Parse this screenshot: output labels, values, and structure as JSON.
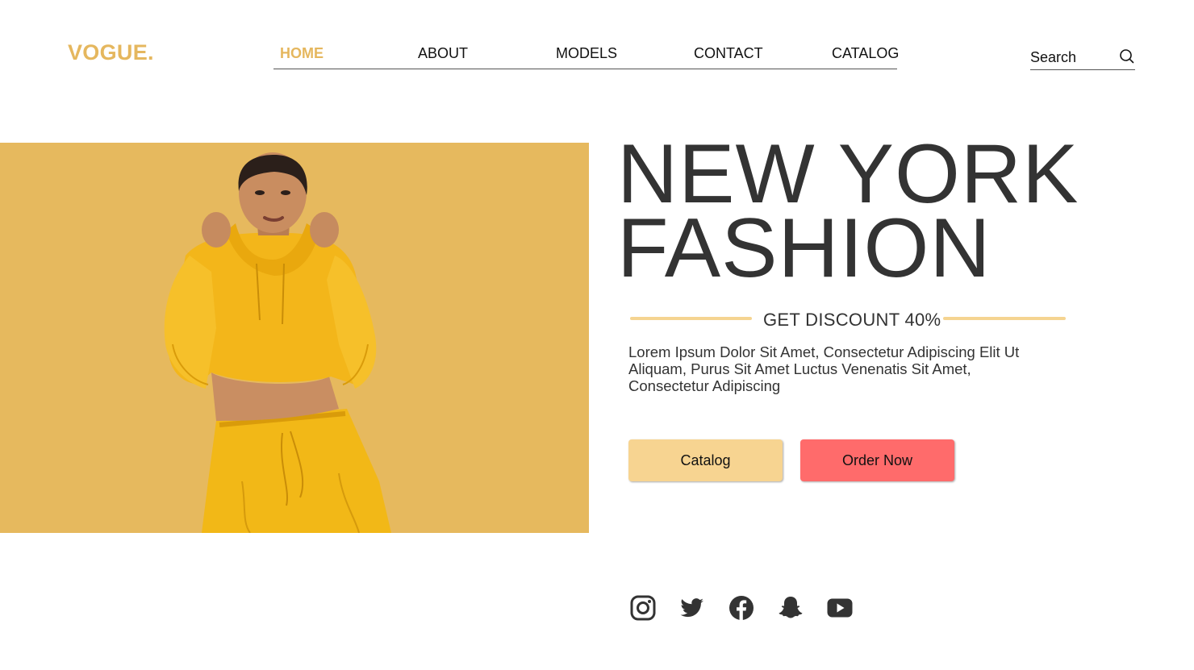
{
  "brand": {
    "logo": "VOGUE.",
    "accent_color": "#e5b75e"
  },
  "nav": {
    "items": [
      {
        "label": "HOME",
        "active": true
      },
      {
        "label": "ABOUT",
        "active": false
      },
      {
        "label": "MODELS",
        "active": false
      },
      {
        "label": "CONTACT",
        "active": false
      },
      {
        "label": "CATALOG",
        "active": false
      }
    ]
  },
  "search": {
    "placeholder": "Search",
    "icon": "search-icon"
  },
  "hero": {
    "image": "model-in-yellow-hoodie-and-sweatpants",
    "background_color": "#e6b95e",
    "headline_line1": "NEW YORK",
    "headline_line2": "FASHION",
    "discount": "GET DISCOUNT 40%",
    "body": "Lorem Ipsum Dolor Sit Amet, Consectetur Adipiscing Elit Ut Aliquam, Purus Sit Amet Luctus Venenatis Sit Amet, Consectetur Adipiscing"
  },
  "buttons": {
    "catalog_label": "Catalog",
    "catalog_color": "#f7d491",
    "order_label": "Order Now",
    "order_color": "#ff6b6b"
  },
  "socials": [
    "instagram-icon",
    "twitter-icon",
    "facebook-icon",
    "snapchat-icon",
    "youtube-icon"
  ]
}
